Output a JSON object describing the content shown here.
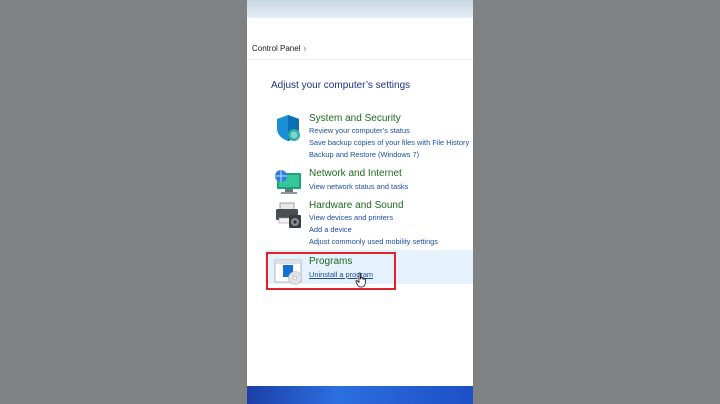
{
  "breadcrumb": {
    "root": "Control Panel",
    "separator": "›"
  },
  "heading": "Adjust your computer’s settings",
  "categories": [
    {
      "title": "System and Security",
      "icon": "shield-icon",
      "links": [
        "Review your computer’s status",
        "Save backup copies of your files with File History",
        "Backup and Restore (Windows 7)"
      ]
    },
    {
      "title": "Network and Internet",
      "icon": "network-icon",
      "links": [
        "View network status and tasks"
      ]
    },
    {
      "title": "Hardware and Sound",
      "icon": "printer-icon",
      "links": [
        "View devices and printers",
        "Add a device",
        "Adjust commonly used mobility settings"
      ]
    },
    {
      "title": "Programs",
      "icon": "programs-icon",
      "links": [
        "Uninstall a program"
      ]
    }
  ],
  "colors": {
    "category_title": "#1e6a1e",
    "link": "#1a4fa8",
    "heading": "#1e3287",
    "highlight": "#e5f1fb",
    "annotation_box": "#e0222b"
  }
}
